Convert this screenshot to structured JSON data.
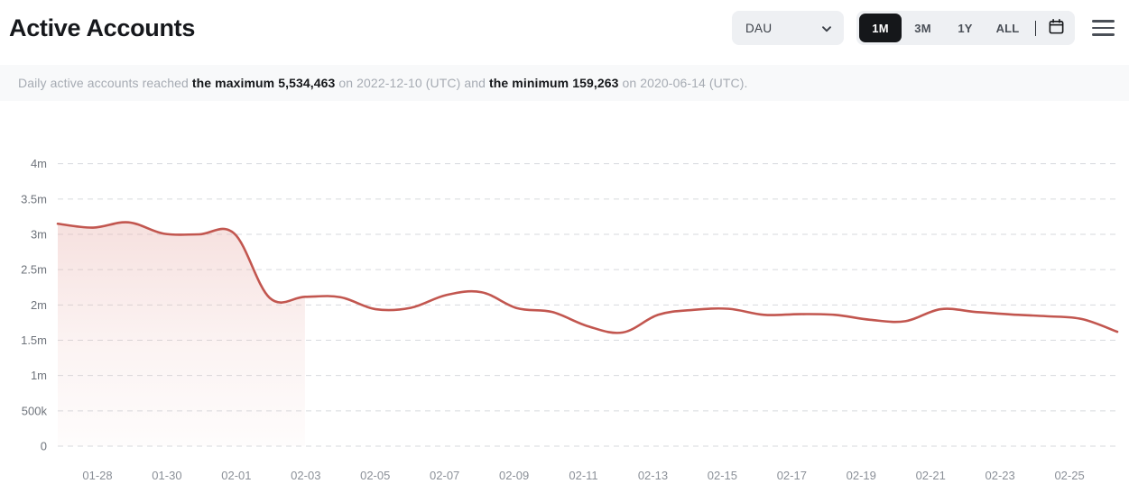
{
  "header": {
    "title": "Active Accounts",
    "metric_select": {
      "value": "DAU",
      "icon": "chevron-down-icon"
    },
    "ranges": [
      {
        "label": "1M",
        "active": true
      },
      {
        "label": "3M",
        "active": false
      },
      {
        "label": "1Y",
        "active": false
      },
      {
        "label": "ALL",
        "active": false
      }
    ],
    "calendar_icon": "calendar-icon",
    "menu_icon": "hamburger-menu-icon"
  },
  "summary": {
    "prefix": "Daily active accounts reached ",
    "max_label": "the maximum 5,534,463",
    "max_value": "5,534,463",
    "mid": " on 2022-12-10 (UTC) and ",
    "max_date": "2022-12-10 (UTC)",
    "min_label": "the minimum 159,263",
    "min_value": "159,263",
    "suffix": " on 2020-06-14 (UTC).",
    "min_date": "2020-06-14 (UTC)"
  },
  "colors": {
    "line": "#c2564f",
    "area_top": "#f6e2e0",
    "area_bottom": "#fdfafa",
    "grid": "#d7dade",
    "banner_bg": "#f8f9fa",
    "control_bg": "#eef0f3",
    "active_bg": "#15171a"
  },
  "chart_data": {
    "type": "line",
    "title": "Active Accounts",
    "xlabel": "",
    "ylabel": "",
    "ylim": [
      0,
      4200000
    ],
    "grid": true,
    "legend": "none",
    "y_ticks": [
      {
        "value": 0,
        "label": "0"
      },
      {
        "value": 500000,
        "label": "500k"
      },
      {
        "value": 1000000,
        "label": "1m"
      },
      {
        "value": 1500000,
        "label": "1.5m"
      },
      {
        "value": 2000000,
        "label": "2m"
      },
      {
        "value": 2500000,
        "label": "2.5m"
      },
      {
        "value": 3000000,
        "label": "3m"
      },
      {
        "value": 3500000,
        "label": "3.5m"
      },
      {
        "value": 4000000,
        "label": "4m"
      }
    ],
    "x_tick_labels": [
      "01-28",
      "01-30",
      "02-01",
      "02-03",
      "02-05",
      "02-07",
      "02-09",
      "02-11",
      "02-13",
      "02-15",
      "02-17",
      "02-19",
      "02-21",
      "02-23",
      "02-25"
    ],
    "series": [
      {
        "name": "DAU",
        "color": "#c2564f",
        "x": [
          "01-27",
          "01-28",
          "01-29",
          "01-30",
          "01-31",
          "02-01",
          "02-02",
          "02-03",
          "02-04",
          "02-05",
          "02-06",
          "02-07",
          "02-08",
          "02-09",
          "02-10",
          "02-11",
          "02-12",
          "02-13",
          "02-14",
          "02-15",
          "02-16",
          "02-17",
          "02-18",
          "02-19",
          "02-20",
          "02-21",
          "02-22",
          "02-23",
          "02-24",
          "02-25",
          "02-26"
        ],
        "values": [
          3150000,
          3095000,
          3170000,
          3010000,
          3000000,
          3010000,
          2100000,
          2115000,
          2110000,
          1940000,
          1960000,
          2140000,
          2180000,
          1955000,
          1900000,
          1700000,
          1610000,
          1860000,
          1930000,
          1945000,
          1860000,
          1870000,
          1860000,
          1790000,
          1770000,
          1940000,
          1900000,
          1865000,
          1840000,
          1800000,
          1620000
        ]
      }
    ]
  }
}
